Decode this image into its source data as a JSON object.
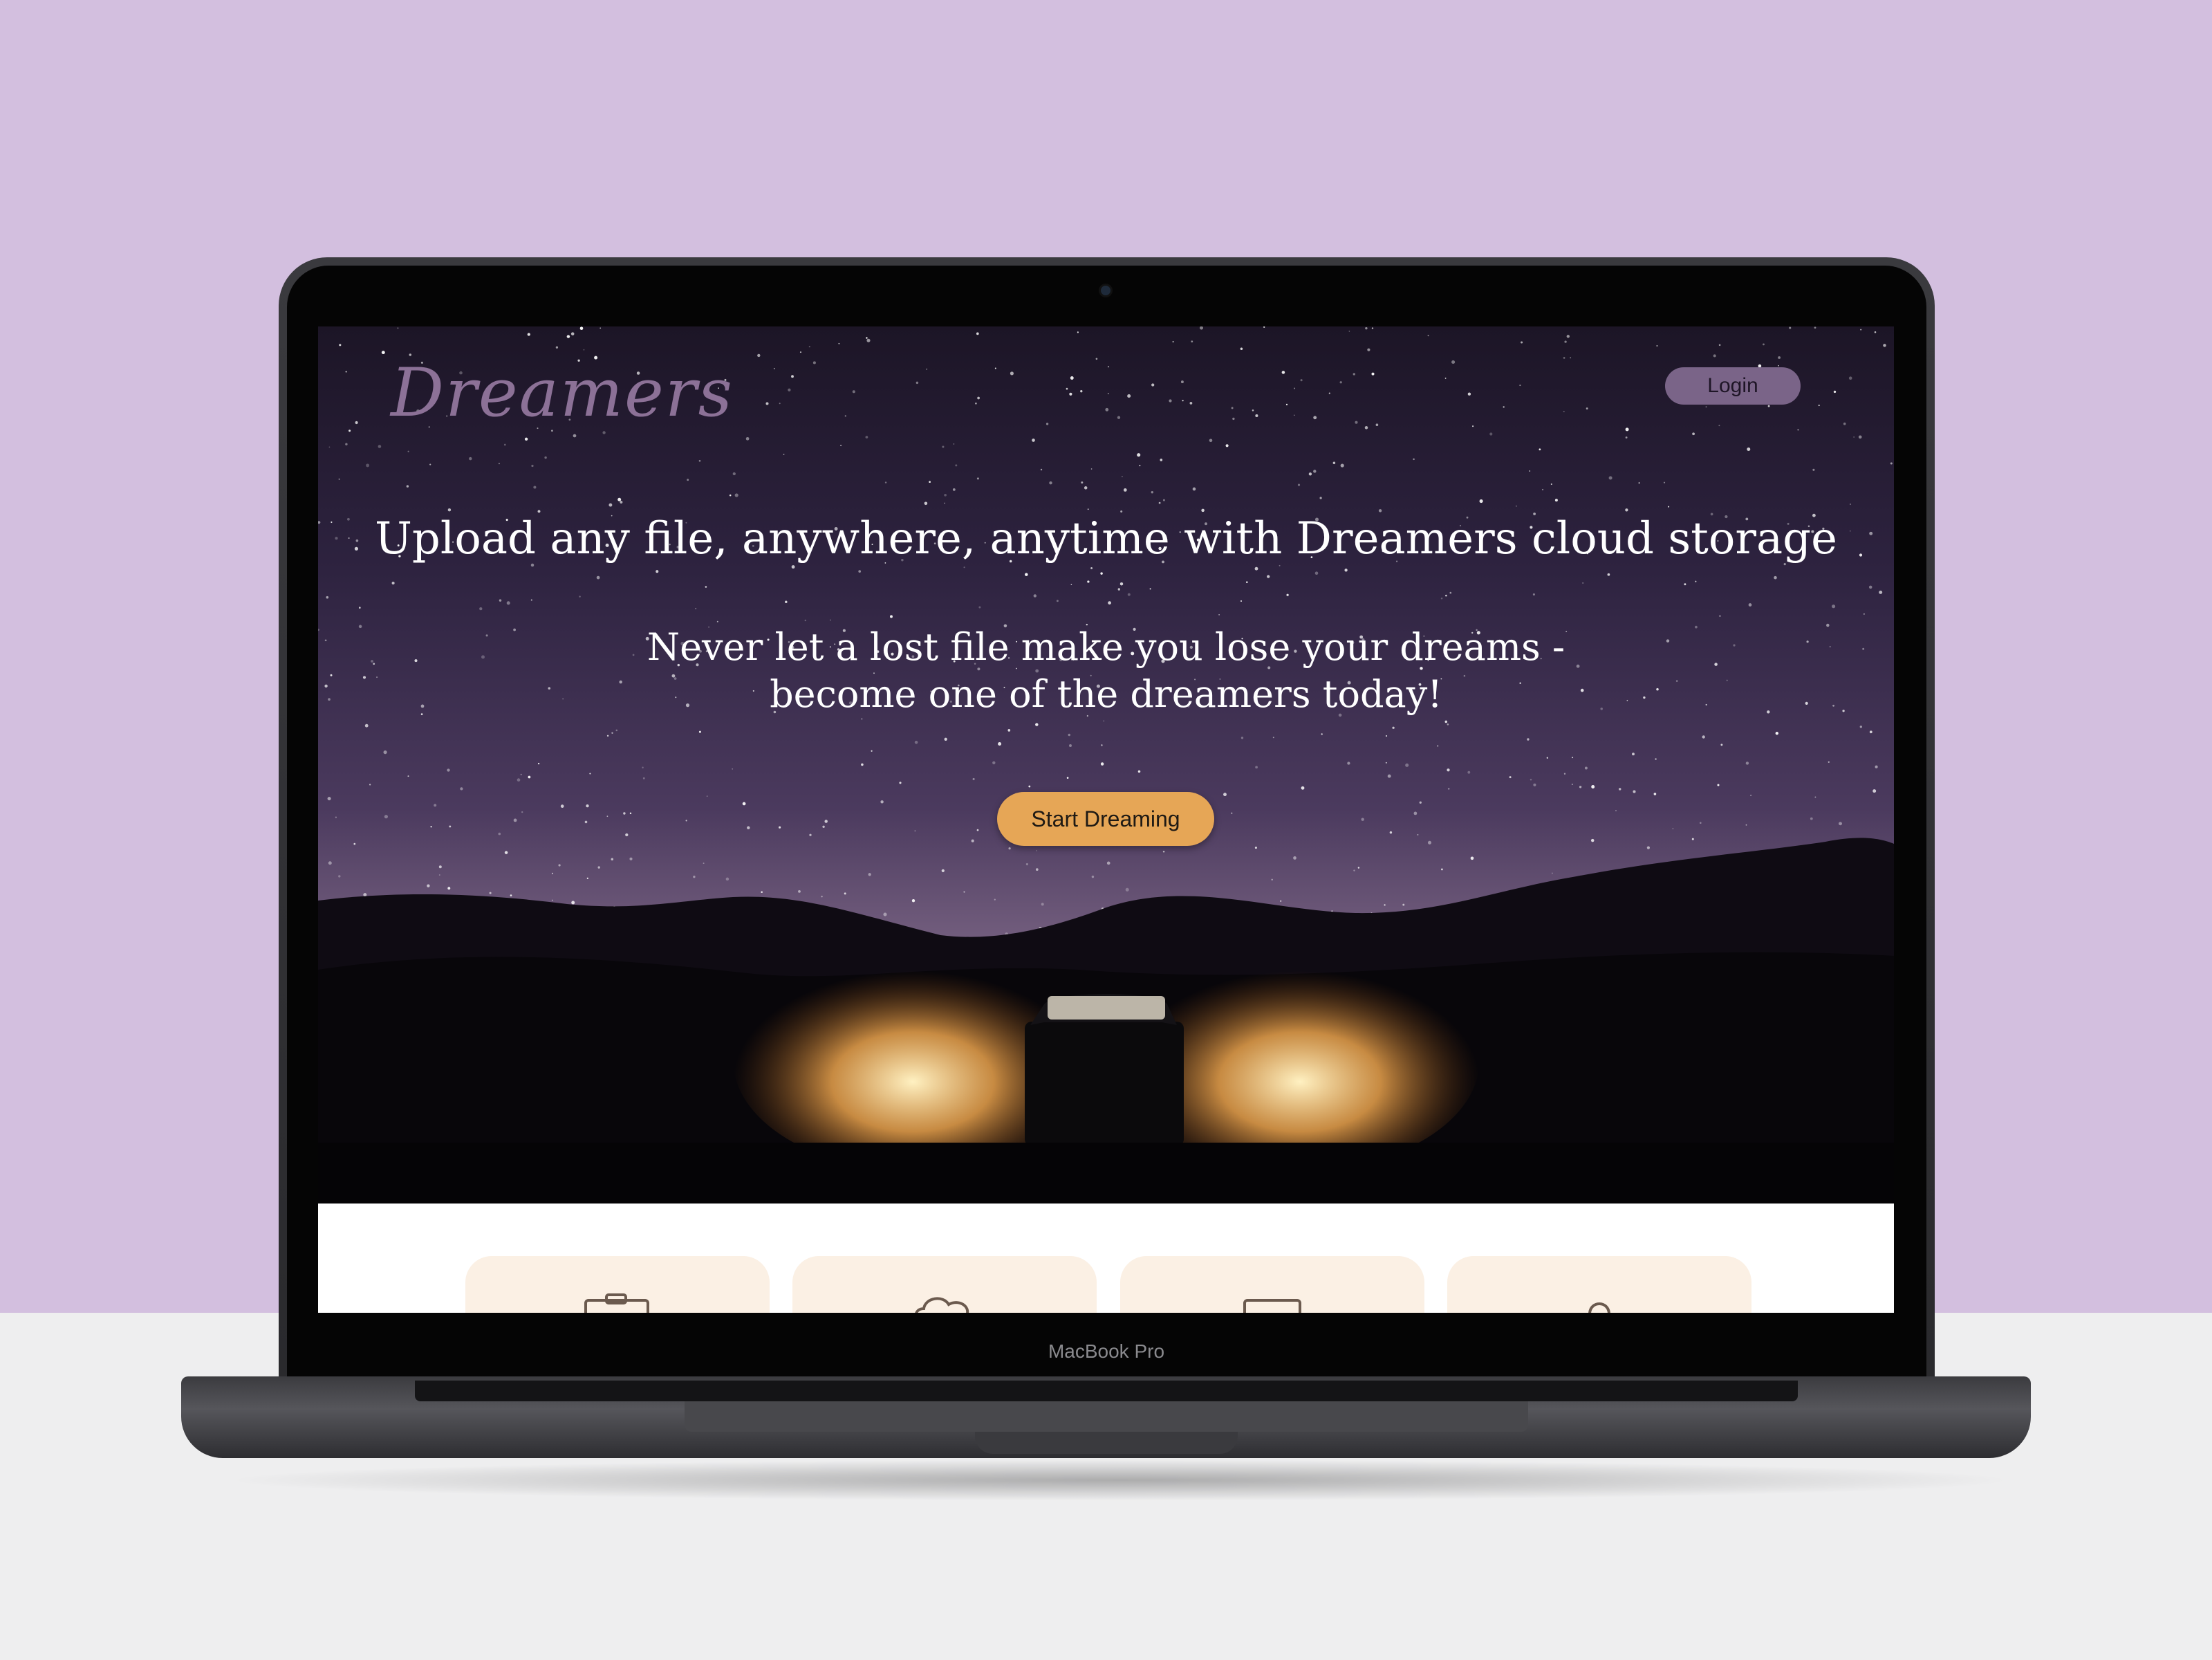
{
  "device": {
    "model_label": "MacBook Pro"
  },
  "site": {
    "logo": "Dreamers",
    "nav": {
      "login_label": "Login"
    },
    "hero": {
      "headline": "Upload any file, anywhere, anytime with Dreamers cloud storage",
      "subline_1": "Never let a lost file make you lose your dreams -",
      "subline_2": "become one of the dreamers today!",
      "cta_label": "Start Dreaming"
    },
    "features": [
      {
        "icon": "briefcase-icon"
      },
      {
        "icon": "cloud-icon"
      },
      {
        "icon": "laptop-icon"
      },
      {
        "icon": "lock-icon"
      }
    ]
  },
  "colors": {
    "background": "#d3bfdf",
    "login_button": "#7a6488",
    "cta_button": "#e6a656",
    "feature_card": "#fbf0e4"
  }
}
